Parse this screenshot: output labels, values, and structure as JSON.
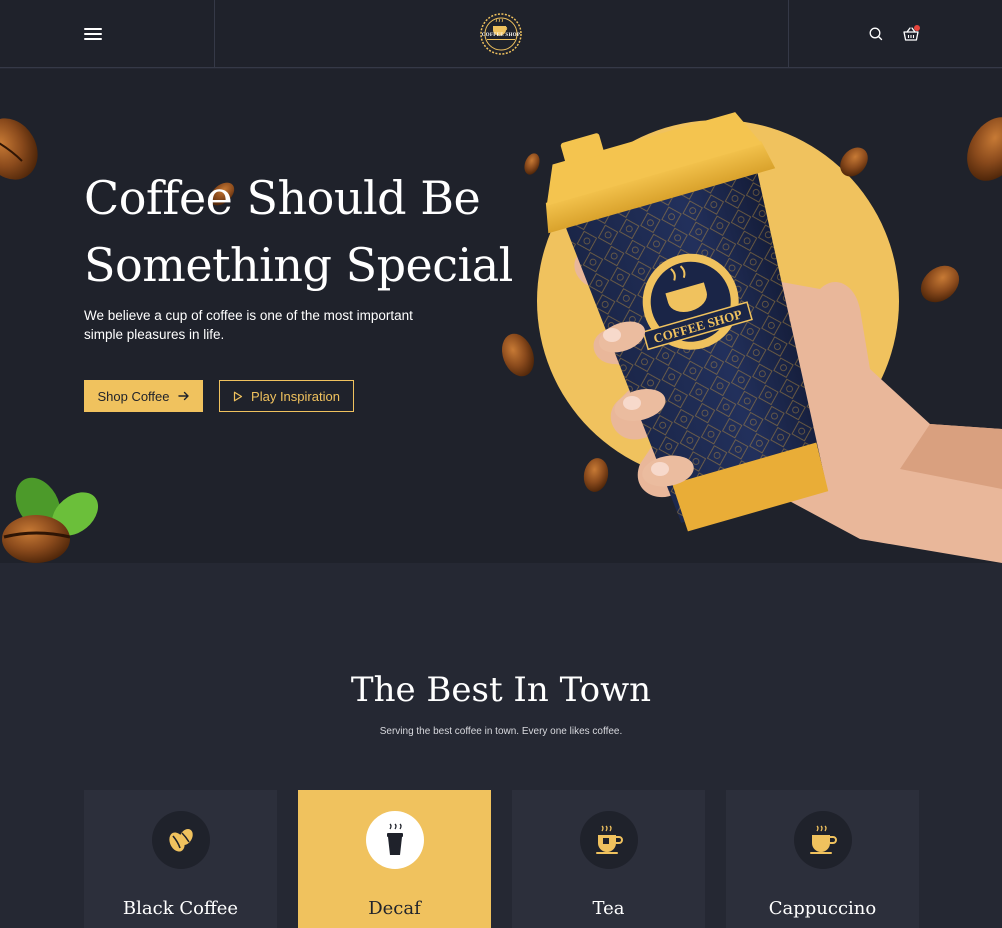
{
  "header": {
    "logo_text": "COFFEE SHOP",
    "menu_icon": "hamburger-menu-icon",
    "search_icon": "search-icon",
    "cart_icon": "shopping-basket-icon"
  },
  "hero": {
    "title_line1": "Coffee Should Be",
    "title_line2": "Something Special",
    "description": "We believe a cup of coffee is one of the most important simple pleasures in life.",
    "shop_button_label": "Shop Coffee",
    "play_button_label": "Play Inspiration",
    "cup_logo_text": "COFFEE SHOP"
  },
  "best": {
    "title": "The Best In Town",
    "subtitle": "Serving the best coffee in town. Every one likes coffee.",
    "cards": [
      {
        "label": "Black Coffee",
        "icon": "coffee-beans-icon",
        "active": false
      },
      {
        "label": "Decaf",
        "icon": "takeaway-cup-icon",
        "active": true
      },
      {
        "label": "Tea",
        "icon": "tea-cup-icon",
        "active": false
      },
      {
        "label": "Cappuccino",
        "icon": "cappuccino-cup-icon",
        "active": false
      }
    ]
  },
  "colors": {
    "accent": "#f0c25e",
    "background": "#252833",
    "header_bg": "#1f222b",
    "card_bg": "#2c2f3b"
  }
}
